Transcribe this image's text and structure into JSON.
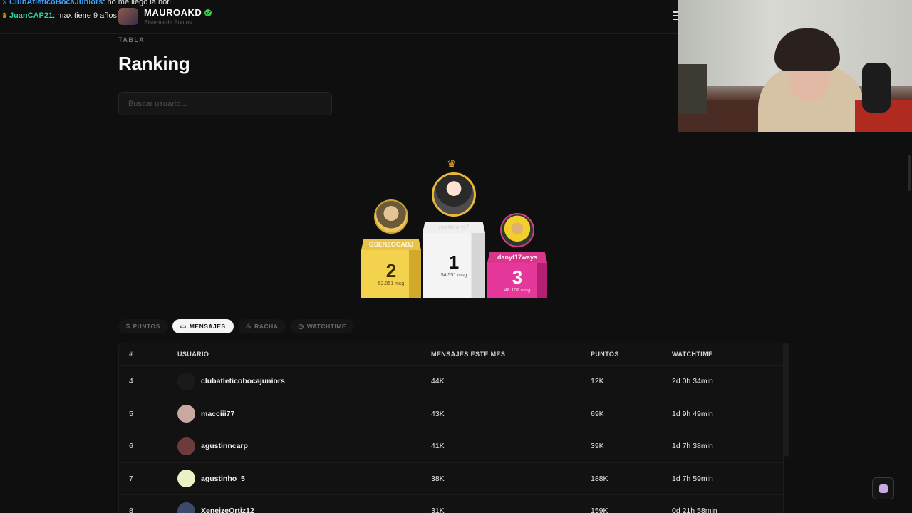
{
  "topbar": {
    "brand_name": "MAUROAKD",
    "brand_sub": "Sistema de Puntos"
  },
  "chat": [
    {
      "user": "ClubAtleticoBocaJuniors",
      "message": ": no me llego la noti",
      "color": "#3fa3ff",
      "icon": "sword-icon"
    },
    {
      "user": "JuanCAP21",
      "message": ": max tiene 9 años",
      "color": "#2fd6a0",
      "icon": "crown-icon"
    }
  ],
  "header": {
    "eyebrow": "TABLA",
    "title": "Ranking"
  },
  "search": {
    "placeholder": "Buscar usuario..."
  },
  "podium": {
    "first": {
      "name": "maticarp7",
      "rank": "1",
      "messages": "54.551 msg"
    },
    "second": {
      "name": "GSENZOCABJ",
      "rank": "2",
      "messages": "52.051 msg"
    },
    "third": {
      "name": "danyf17ways",
      "rank": "3",
      "messages": "48.102 msg"
    }
  },
  "tabs": [
    {
      "label": "PUNTOS",
      "icon": "dollar-icon",
      "active": false
    },
    {
      "label": "MENSAJES",
      "icon": "chat-bubble-icon",
      "active": true
    },
    {
      "label": "RACHA",
      "icon": "flame-icon",
      "active": false
    },
    {
      "label": "WATCHTIME",
      "icon": "clock-icon",
      "active": false
    }
  ],
  "table": {
    "headers": {
      "rank": "#",
      "user": "USUARIO",
      "messages": "MENSAJES ESTE MES",
      "points": "PUNTOS",
      "watchtime": "WATCHTIME"
    },
    "rows": [
      {
        "rank": "4",
        "user": "clubatleticobocajuniors",
        "messages": "44K",
        "points": "12K",
        "watchtime": "2d 0h 34min",
        "avatar_color": "#1a1a1a"
      },
      {
        "rank": "5",
        "user": "macciii77",
        "messages": "43K",
        "points": "69K",
        "watchtime": "1d 9h 49min",
        "avatar_color": "#c7a9a0"
      },
      {
        "rank": "6",
        "user": "agustinncarp",
        "messages": "41K",
        "points": "39K",
        "watchtime": "1d 7h 38min",
        "avatar_color": "#6e3b3b"
      },
      {
        "rank": "7",
        "user": "agustinho_5",
        "messages": "38K",
        "points": "188K",
        "watchtime": "1d 7h 59min",
        "avatar_color": "#e8f2c4"
      },
      {
        "rank": "8",
        "user": "XeneizeOrtiz12",
        "messages": "31K",
        "points": "159K",
        "watchtime": "0d 21h 58min",
        "avatar_color": "#3b4a6a"
      }
    ]
  }
}
